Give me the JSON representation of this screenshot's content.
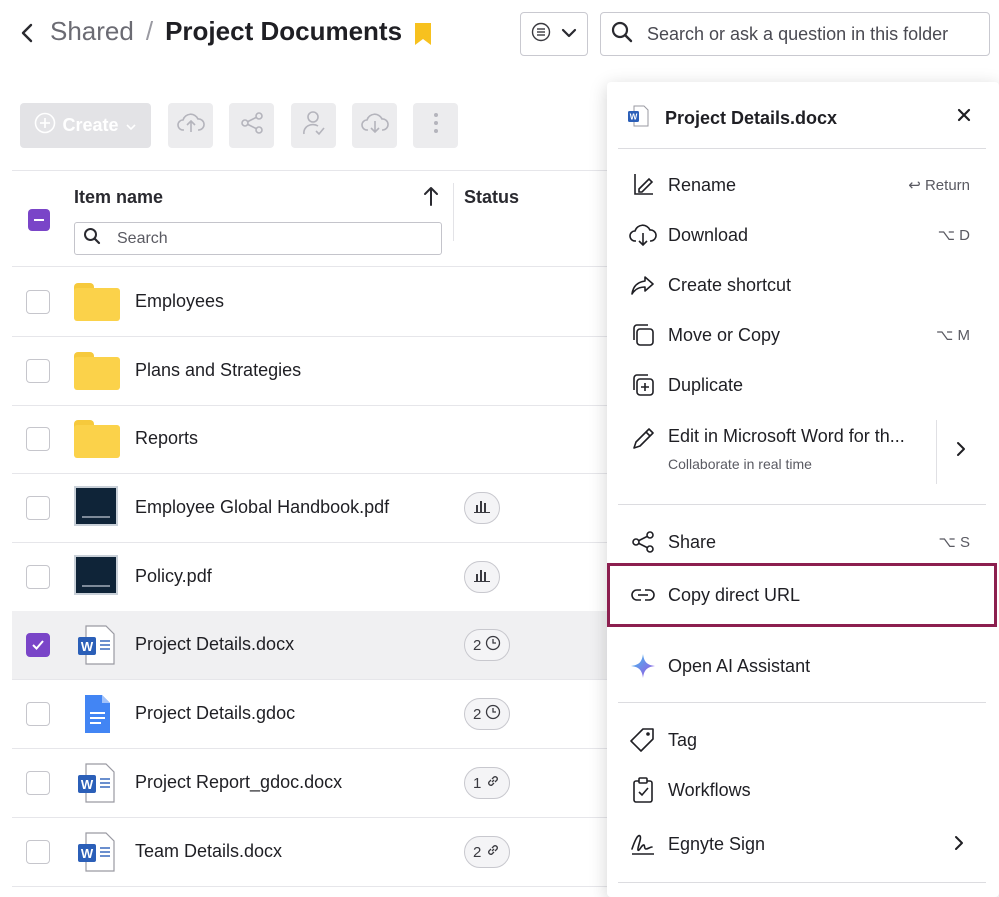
{
  "header": {
    "breadcrumb_parent": "Shared",
    "breadcrumb_separator": "/",
    "breadcrumb_current": "Project Documents",
    "search_placeholder": "Search or ask a question in this folder"
  },
  "toolbar": {
    "create_label": "Create"
  },
  "table": {
    "column_name": "Item name",
    "column_status": "Status",
    "search_placeholder": "Search",
    "rows": [
      {
        "name": "Employees",
        "type": "folder",
        "status": ""
      },
      {
        "name": "Plans and Strategies",
        "type": "folder",
        "status": ""
      },
      {
        "name": "Reports",
        "type": "folder",
        "status": ""
      },
      {
        "name": "Employee Global Handbook.pdf",
        "type": "pdf",
        "status_icon": "chart-icon"
      },
      {
        "name": "Policy.pdf",
        "type": "pdf",
        "status_icon": "chart-icon"
      },
      {
        "name": "Project Details.docx",
        "type": "docx",
        "status_count": "2",
        "status_icon": "clock-icon",
        "selected": true
      },
      {
        "name": "Project Details.gdoc",
        "type": "gdoc",
        "status_count": "2",
        "status_icon": "clock-icon"
      },
      {
        "name": "Project Report_gdoc.docx",
        "type": "docx",
        "status_count": "1",
        "status_icon": "link-icon"
      },
      {
        "name": "Team Details.docx",
        "type": "docx",
        "status_count": "2",
        "status_icon": "link-icon"
      }
    ]
  },
  "menu": {
    "file_name": "Project Details.docx",
    "items": {
      "rename": {
        "label": "Rename",
        "shortcut": "↩ Return"
      },
      "download": {
        "label": "Download",
        "shortcut": "⌥ D"
      },
      "shortcut": {
        "label": "Create shortcut"
      },
      "move": {
        "label": "Move or Copy",
        "shortcut": "⌥ M"
      },
      "duplicate": {
        "label": "Duplicate"
      },
      "edit_word": {
        "label": "Edit in Microsoft Word for th...",
        "sublabel": "Collaborate in real time"
      },
      "share": {
        "label": "Share",
        "shortcut": "⌥ S"
      },
      "copy_url": {
        "label": "Copy direct URL"
      },
      "ai": {
        "label": "Open AI Assistant"
      },
      "tag": {
        "label": "Tag"
      },
      "workflows": {
        "label": "Workflows"
      },
      "sign": {
        "label": "Egnyte Sign"
      }
    }
  },
  "colors": {
    "accent_purple": "#7a45c8",
    "folder_yellow": "#fbd24a",
    "word_blue": "#2b5fb8",
    "highlight_border": "#8c1f4f"
  }
}
